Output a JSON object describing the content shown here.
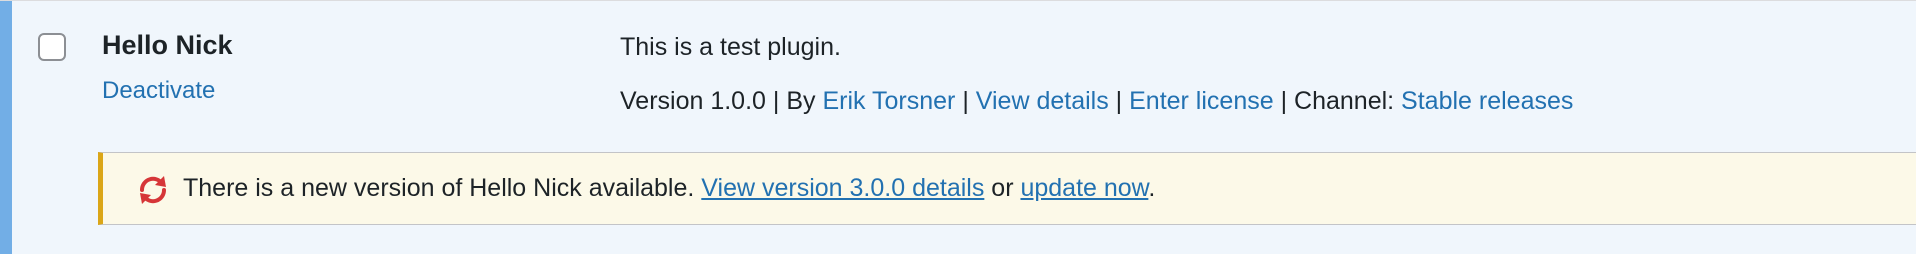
{
  "plugin": {
    "name": "Hello Nick",
    "deactivate_label": "Deactivate",
    "description": "This is a test plugin.",
    "meta": {
      "version_text": "Version 1.0.0",
      "sep1": " | By ",
      "author": "Erik Torsner",
      "sep2": " | ",
      "view_details": "View details",
      "sep3": " | ",
      "enter_license": "Enter license",
      "sep4": " | Channel: ",
      "channel": "Stable releases"
    }
  },
  "update_notice": {
    "icon": "update-icon",
    "text_before": "There is a new version of Hello Nick available. ",
    "view_version_link": "View version 3.0.0 details",
    "text_middle": " or ",
    "update_now_link": "update now",
    "text_after": "."
  },
  "colors": {
    "active_stripe": "#72aee6",
    "row_background": "#f0f6fc",
    "link": "#2271b1",
    "notice_background": "#fcf9e8",
    "notice_border": "#dba617",
    "update_icon": "#d63638"
  }
}
